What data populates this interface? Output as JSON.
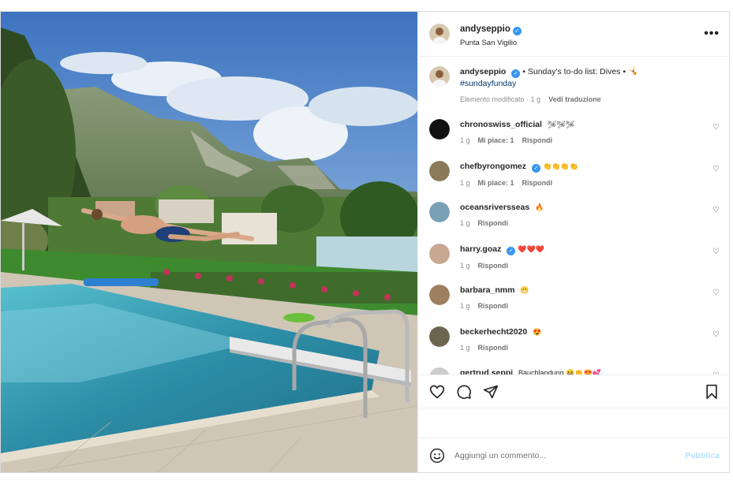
{
  "post": {
    "username": "andyseppio",
    "location": "Punta San Vigilio",
    "more_label": "•••"
  },
  "caption": {
    "username": "andyseppio",
    "text": "• Sunday's to-do list: Dives • 🤸",
    "hashtag": "#sundayfunday",
    "edited": "Elemento modificato · 1 g",
    "translate": "Vedi traduzione"
  },
  "comments": [
    {
      "username": "chronoswiss_official",
      "text": "🛩🛩🛩",
      "time": "1 g",
      "likes": "Mi piace: 1",
      "reply": "Rispondi",
      "avatar_color": "#111111",
      "verified": false
    },
    {
      "username": "chefbyrongomez",
      "text": "👏👏👏👏",
      "time": "1 g",
      "likes": "Mi piace: 1",
      "reply": "Rispondi",
      "avatar_color": "#8a7a5a",
      "verified": true
    },
    {
      "username": "oceansriversseas",
      "text": "🔥",
      "time": "1 g",
      "likes": "",
      "reply": "Rispondi",
      "avatar_color": "#7aa0b8",
      "verified": false
    },
    {
      "username": "harry.goaz",
      "text": "❤️❤️❤️",
      "time": "1 g",
      "likes": "",
      "reply": "Rispondi",
      "avatar_color": "#c8a890",
      "verified": true
    },
    {
      "username": "barbara_nmm",
      "text": "😁",
      "time": "1 g",
      "likes": "",
      "reply": "Rispondi",
      "avatar_color": "#9c8060",
      "verified": false
    },
    {
      "username": "beckerhecht2020",
      "text": "😍",
      "time": "1 g",
      "likes": "",
      "reply": "Rispondi",
      "avatar_color": "#6d6450",
      "verified": false
    },
    {
      "username": "gertrud.seppi",
      "text": "Bauchlandung 😆👏😍💕",
      "time": "",
      "likes": "",
      "reply": "",
      "avatar_color": "#cccccc",
      "verified": false
    }
  ],
  "actions": {
    "like_icon": "heart-icon",
    "comment_icon": "comment-icon",
    "share_icon": "paper-plane-icon",
    "save_icon": "bookmark-icon"
  },
  "add_comment": {
    "placeholder": "Aggiungi un commento...",
    "publish_label": "Pubblica"
  },
  "colors": {
    "accent": "#3897f0",
    "publish_disabled": "#b2dffc",
    "sky": "#4c86c8",
    "pool": "#3fa6b8"
  }
}
